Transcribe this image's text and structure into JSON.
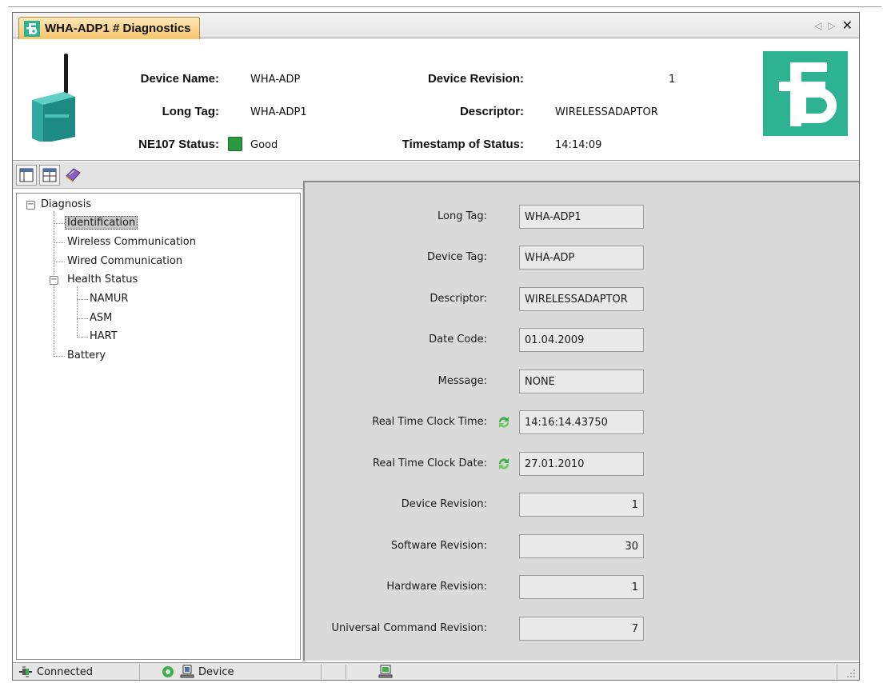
{
  "window": {
    "tab_title": "WHA-ADP1 # Diagnostics"
  },
  "header": {
    "device_name_label": "Device Name:",
    "device_name_value": "WHA-ADP",
    "long_tag_label": "Long Tag:",
    "long_tag_value": "WHA-ADP1",
    "ne107_label": "NE107 Status:",
    "ne107_value": "Good",
    "device_revision_label": "Device Revision:",
    "device_revision_value": "1",
    "descriptor_label": "Descriptor:",
    "descriptor_value": "WIRELESSADAPTOR",
    "timestamp_label": "Timestamp of Status:",
    "timestamp_value": "14:14:09",
    "status_color": "#2a9a3e",
    "brand_color": "#2db391"
  },
  "toolbar": {
    "icons": [
      "layout-view-icon",
      "table-view-icon",
      "book-icon"
    ]
  },
  "tree": {
    "root": "Diagnosis",
    "items": {
      "identification": "Identification",
      "wireless": "Wireless Communication",
      "wired": "Wired Communication",
      "health": "Health Status",
      "namur": "NAMUR",
      "asm": "ASM",
      "hart": "HART",
      "battery": "Battery"
    }
  },
  "detail": {
    "fields": [
      {
        "label": "Long Tag:",
        "value": "WHA-ADP1"
      },
      {
        "label": "Device Tag:",
        "value": "WHA-ADP"
      },
      {
        "label": "Descriptor:",
        "value": "WIRELESSADAPTOR"
      },
      {
        "label": "Date Code:",
        "value": "01.04.2009"
      },
      {
        "label": "Message:",
        "value": "NONE"
      },
      {
        "label": "Real Time Clock Time:",
        "value": "14:16:14.43750"
      },
      {
        "label": "Real Time Clock Date:",
        "value": "27.01.2010"
      },
      {
        "label": "Device Revision:",
        "value": "1"
      },
      {
        "label": "Software  Revision:",
        "value": "30"
      },
      {
        "label": "Hardware Revision:",
        "value": "1"
      },
      {
        "label": "Universal Command Revision:",
        "value": "7"
      }
    ]
  },
  "statusbar": {
    "connection": "Connected",
    "source": "Device"
  }
}
